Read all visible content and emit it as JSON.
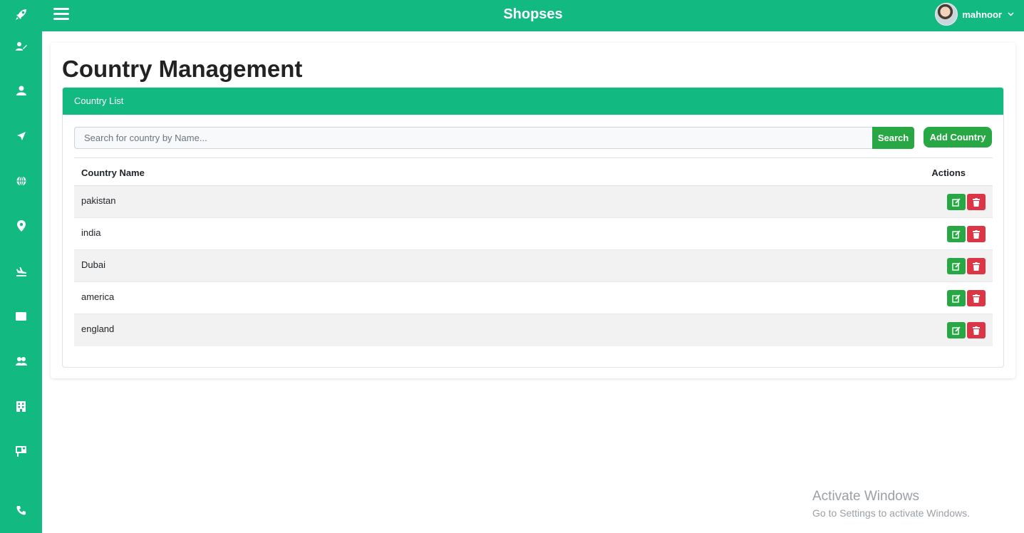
{
  "app": {
    "brand": "Shopses"
  },
  "user": {
    "name": "mahnoor"
  },
  "sidebar": {
    "icons": [
      "rocket-icon",
      "user-edit-icon",
      "user-icon",
      "plane-icon",
      "globe-icon",
      "map-pin-icon",
      "plane-landing-icon",
      "envelope-icon",
      "users-icon",
      "building-icon",
      "sign-icon",
      "phone-icon"
    ]
  },
  "page": {
    "title": "Country Management"
  },
  "panel": {
    "header": "Country List",
    "search_placeholder": "Search for country by Name...",
    "search_label": "Search",
    "add_label": "Add Country"
  },
  "table": {
    "columns": {
      "name": "Country Name",
      "actions": "Actions"
    },
    "rows": [
      {
        "name": "pakistan"
      },
      {
        "name": "india"
      },
      {
        "name": "Dubai"
      },
      {
        "name": "america"
      },
      {
        "name": "england"
      }
    ]
  },
  "watermark": {
    "line1": "Activate Windows",
    "line2": "Go to Settings to activate Windows."
  },
  "colors": {
    "primary": "#12b981",
    "success": "#28a745",
    "danger": "#dc3545"
  }
}
